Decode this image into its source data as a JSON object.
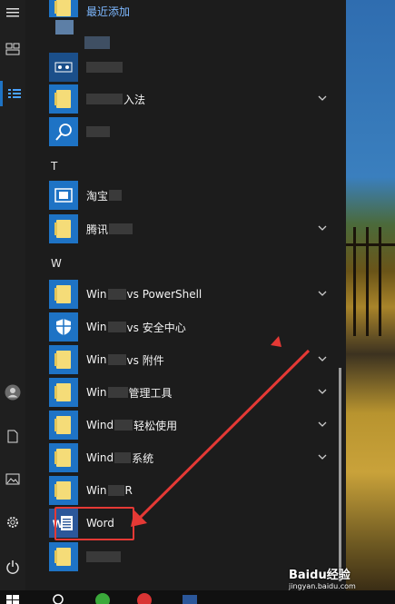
{
  "section_header": "最近添加",
  "letters": {
    "t": "T",
    "w": "W"
  },
  "apps": [
    {
      "label": "入法",
      "tile": "folder"
    },
    {
      "label": "",
      "tile": "search"
    },
    {
      "label": "淘宝",
      "tile": "shop"
    },
    {
      "label": "腾讯",
      "tile": "folder"
    },
    {
      "label": "Win",
      "suffix": "vs PowerShell",
      "tile": "folder"
    },
    {
      "label": "Win",
      "suffix": "vs 安全中心",
      "tile": "shield"
    },
    {
      "label": "Win",
      "suffix": "vs 附件",
      "tile": "folder"
    },
    {
      "label": "Win",
      "suffix": "管理工具",
      "tile": "folder"
    },
    {
      "label": "Wind",
      "suffix": "轻松使用",
      "tile": "folder"
    },
    {
      "label": "Wind",
      "suffix": "系统",
      "tile": "folder"
    },
    {
      "label": "Win",
      "suffix": "R",
      "tile": "folder"
    },
    {
      "label": "Word",
      "tile": "word"
    },
    {
      "label": "",
      "tile": "folder"
    }
  ],
  "watermark": "Baidu经验",
  "watermark_url": "jingyan.baidu.com",
  "colors": {
    "accent": "#1e73c5",
    "highlight": "#e53935"
  }
}
